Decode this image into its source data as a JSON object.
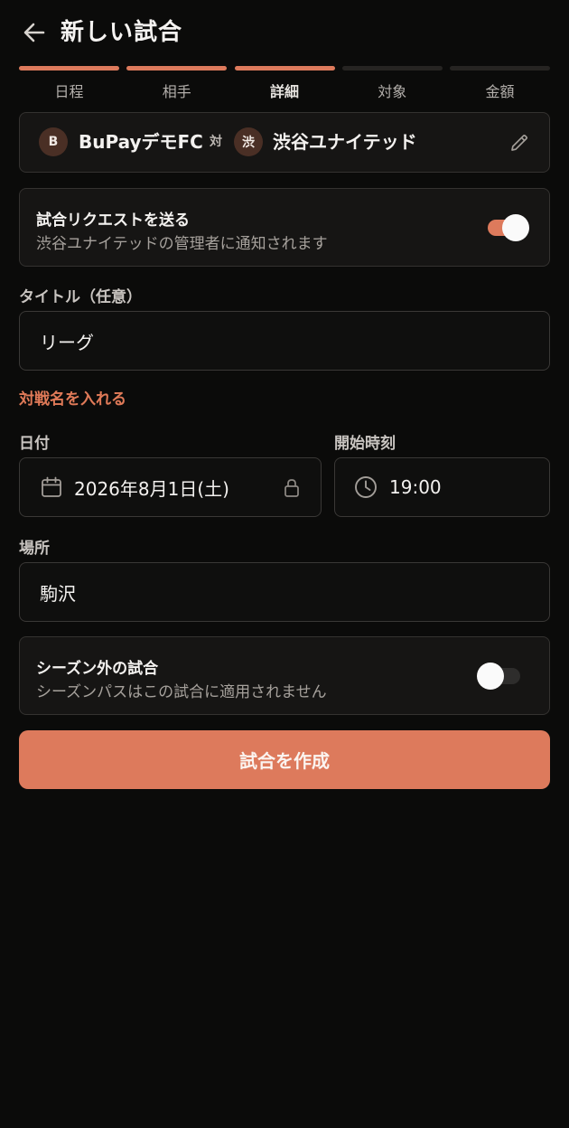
{
  "header": {
    "title": "新しい試合",
    "back_icon": "arrow-left-icon"
  },
  "steps": [
    {
      "label": "日程",
      "state": "done"
    },
    {
      "label": "相手",
      "state": "done"
    },
    {
      "label": "詳細",
      "state": "current"
    },
    {
      "label": "対象",
      "state": "todo"
    },
    {
      "label": "金額",
      "state": "todo"
    }
  ],
  "match": {
    "home_initial": "B",
    "home_name": "BuPayデモFC",
    "vs": "対",
    "away_initial": "渋",
    "away_name": "渋谷ユナイテッド",
    "edit_icon": "pencil-icon"
  },
  "request": {
    "title": "試合リクエストを送る",
    "subtitle": "渋谷ユナイテッドの管理者に通知されます",
    "enabled": true
  },
  "title_field": {
    "label": "タイトル（任意）",
    "value": "リーグ",
    "hint": "対戦名を入れる"
  },
  "date_field": {
    "label": "日付",
    "value": "2026年8月1日(土)",
    "icon": "calendar-icon",
    "lock_icon": "lock-icon"
  },
  "time_field": {
    "label": "開始時刻",
    "value": "19:00",
    "icon": "clock-icon"
  },
  "location_field": {
    "label": "場所",
    "value": "駒沢"
  },
  "offseason": {
    "title": "シーズン外の試合",
    "subtitle": "シーズンパスはこの試合に適用されません",
    "enabled": false
  },
  "submit_label": "試合を作成",
  "colors": {
    "accent": "#dd7a5c",
    "background": "#0b0b0a",
    "card": "#161514"
  }
}
